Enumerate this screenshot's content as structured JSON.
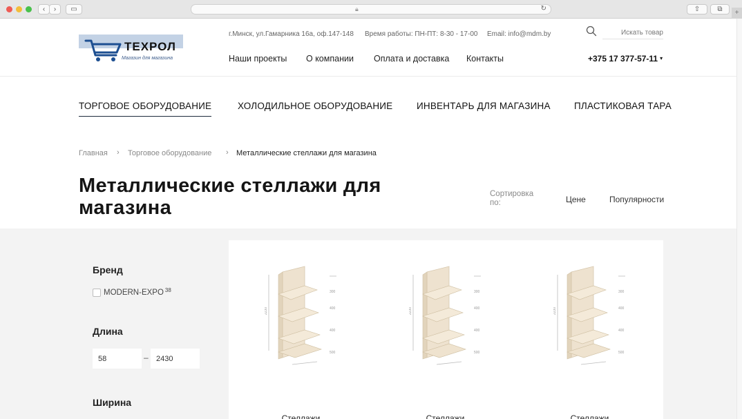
{
  "browser": {
    "back_icon": "chevron-left-icon",
    "forward_icon": "chevron-right-icon",
    "lock_icon": "lock-icon",
    "reload_icon": "reload-icon",
    "url": ""
  },
  "header": {
    "logo": {
      "brand": "ТЕХРОЛ",
      "slogan": "Магазин для магазина"
    },
    "address": "г.Минск, ул.Гамарника 16а, оф.147-148",
    "hours": "Время работы: ПН-ПТ: 8-30 - 17-00",
    "email": "Email: info@mdm.by",
    "nav": [
      "Наши проекты",
      "О компании",
      "Оплата и доставка",
      "Контакты"
    ],
    "search_placeholder": "Искать товар",
    "phone": "+375 17 377-57-11",
    "phone_caret": "▾"
  },
  "categories": [
    "ТОРГОВОЕ ОБОРУДОВАНИЕ",
    "ХОЛОДИЛЬНОЕ ОБОРУДОВАНИЕ",
    "ИНВЕНТАРЬ ДЛЯ МАГАЗИНА",
    "ПЛАСТИКОВАЯ ТАРА"
  ],
  "breadcrumb": {
    "items": [
      "Главная",
      "Торговое оборудование",
      "Металлические стеллажи для магазина"
    ],
    "separator": "›"
  },
  "page": {
    "title_line1": "Металлические стеллажи для",
    "title_line2": "магазина",
    "sort_label_line1": "Сортировка",
    "sort_label_line2": "по:",
    "sort_options": [
      "Цене",
      "Популярности"
    ]
  },
  "filters": {
    "brand": {
      "title": "Бренд",
      "options": [
        {
          "label": "MODERN-EXPO",
          "count": "38",
          "checked": false
        }
      ]
    },
    "length": {
      "title": "Длина",
      "min": "58",
      "max": "2430",
      "dash": "–"
    },
    "width": {
      "title": "Ширина"
    }
  },
  "products": [
    {
      "name": "Стеллажи",
      "dims": [
        "2230",
        "300",
        "400",
        "400",
        "500"
      ]
    },
    {
      "name": "Стеллажи",
      "dims": [
        "2230",
        "300",
        "400",
        "400",
        "500"
      ]
    },
    {
      "name": "Стеллажи",
      "dims": [
        "2230",
        "300",
        "400",
        "400",
        "500"
      ]
    }
  ],
  "colors": {
    "accent_dark": "#1b2a3a",
    "logo_blue": "#1d4f91",
    "logo_bg": "#c3d2e5",
    "shelf_beige": "#eee2cf",
    "content_bg": "#f3f3f3"
  }
}
